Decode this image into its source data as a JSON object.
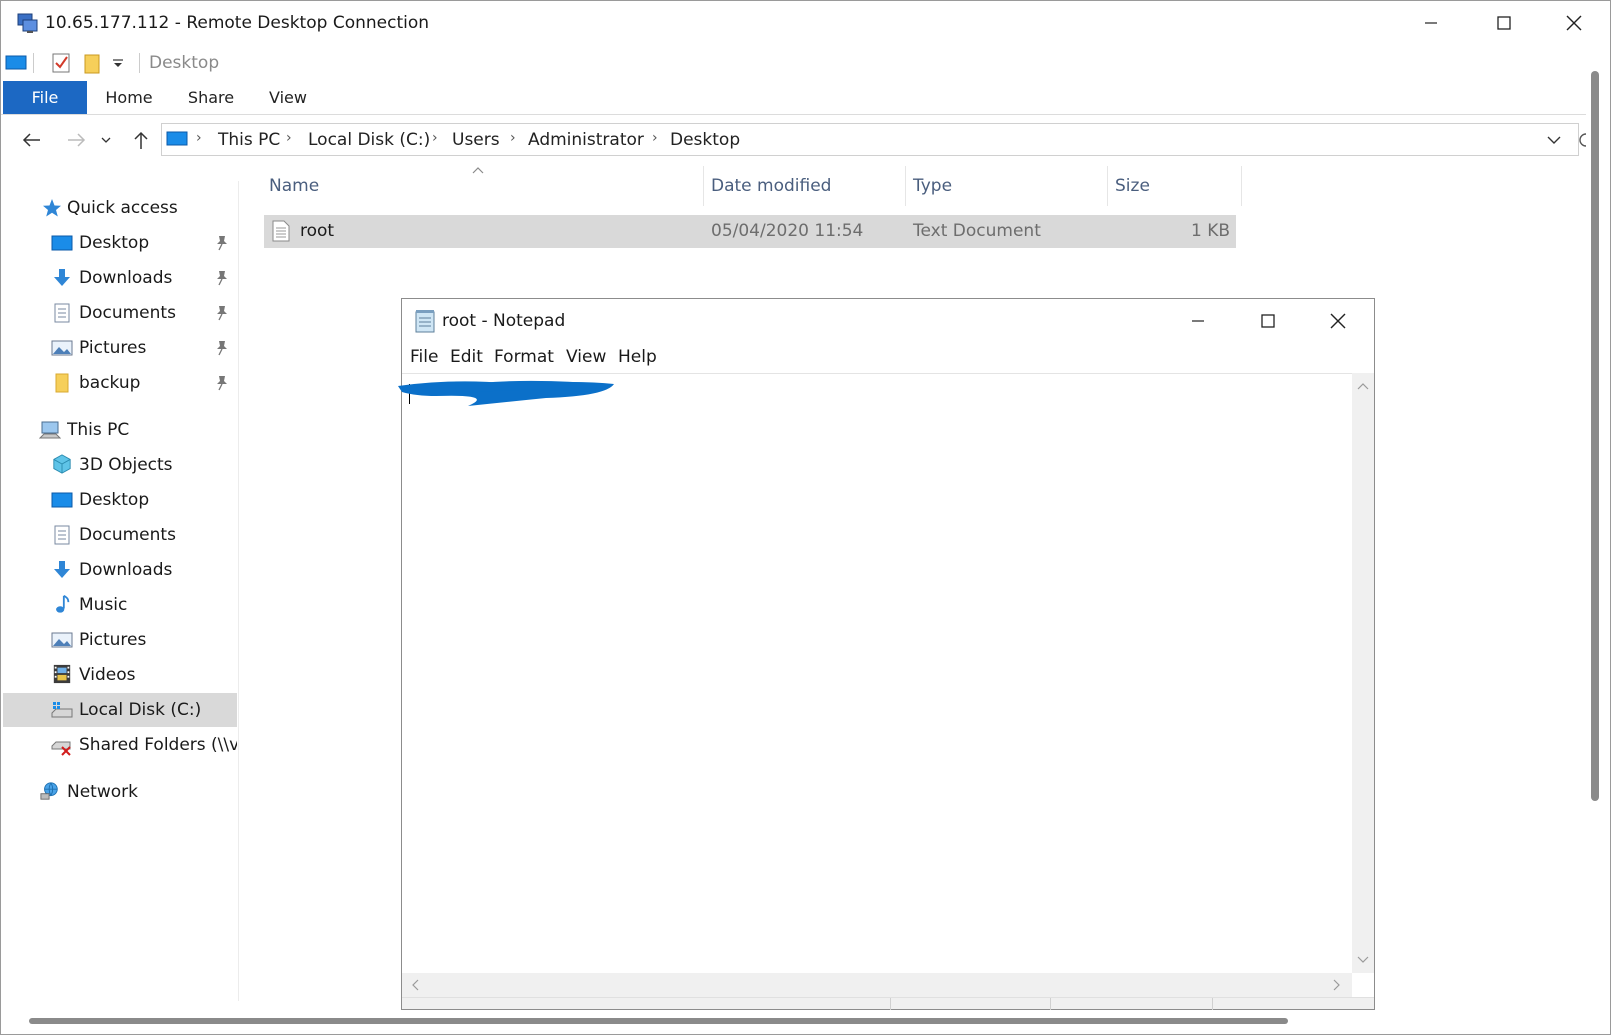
{
  "rdp": {
    "title": "10.65.177.112 - Remote Desktop Connection"
  },
  "explorer": {
    "qat_title": "Desktop",
    "ribbon_tabs": [
      "File",
      "Home",
      "Share",
      "View"
    ],
    "breadcrumbs": [
      "This PC",
      "Local Disk (C:)",
      "Users",
      "Administrator",
      "Desktop"
    ],
    "nav": {
      "quick_access": "Quick access",
      "quick_items": [
        "Desktop",
        "Downloads",
        "Documents",
        "Pictures",
        "backup"
      ],
      "this_pc": "This PC",
      "pc_items": [
        "3D Objects",
        "Desktop",
        "Documents",
        "Downloads",
        "Music",
        "Pictures",
        "Videos",
        "Local Disk (C:)",
        "Shared Folders (\\\\vr"
      ],
      "network": "Network"
    },
    "columns": [
      "Name",
      "Date modified",
      "Type",
      "Size"
    ],
    "files": [
      {
        "name": "root",
        "date": "05/04/2020 11:54",
        "type": "Text Document",
        "size": "1 KB"
      }
    ]
  },
  "notepad": {
    "title": "root - Notepad",
    "menu": [
      "File",
      "Edit",
      "Format",
      "View",
      "Help"
    ]
  },
  "colors": {
    "accent": "#1c68c3",
    "redaction": "#0b70c9",
    "selection": "#d9d9d9"
  }
}
